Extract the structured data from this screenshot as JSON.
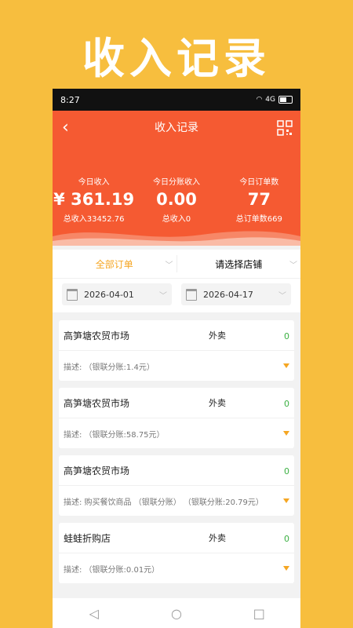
{
  "promo": {
    "title": "收入记录"
  },
  "status_bar": {
    "time": "8:27",
    "signal": "4G"
  },
  "header": {
    "title": "收入记录"
  },
  "stats": [
    {
      "label": "今日收入",
      "value": "¥ 361.19",
      "sub": "总收入33452.76"
    },
    {
      "label": "今日分账收入",
      "value": "0.00",
      "sub": "总收入0"
    },
    {
      "label": "今日订单数",
      "value": "77",
      "sub": "总订单数669"
    }
  ],
  "filters": {
    "order_type": "全部订单",
    "store_placeholder": "请选择店铺",
    "start_date": "2026-04-01",
    "end_date": "2026-04-17"
  },
  "records": [
    {
      "store": "高笋塘农贸市场",
      "type": "外卖",
      "amount": "0",
      "desc": "描述:  （银联分账:1.4元）"
    },
    {
      "store": "高笋塘农贸市场",
      "type": "外卖",
      "amount": "0",
      "desc": "描述:  （银联分账:58.75元）"
    },
    {
      "store": "高笋塘农贸市场",
      "type": "",
      "amount": "0",
      "desc": "描述: 购买餐饮商品 （银联分账） （银联分账:20.79元）"
    },
    {
      "store": "蛙蛙折购店",
      "type": "外卖",
      "amount": "0",
      "desc": "描述:  （银联分账:0.01元）"
    }
  ],
  "colors": {
    "brand": "#F55A32",
    "background": "#F7BE3E",
    "accent": "#F5A623",
    "positive": "#3CB043"
  }
}
